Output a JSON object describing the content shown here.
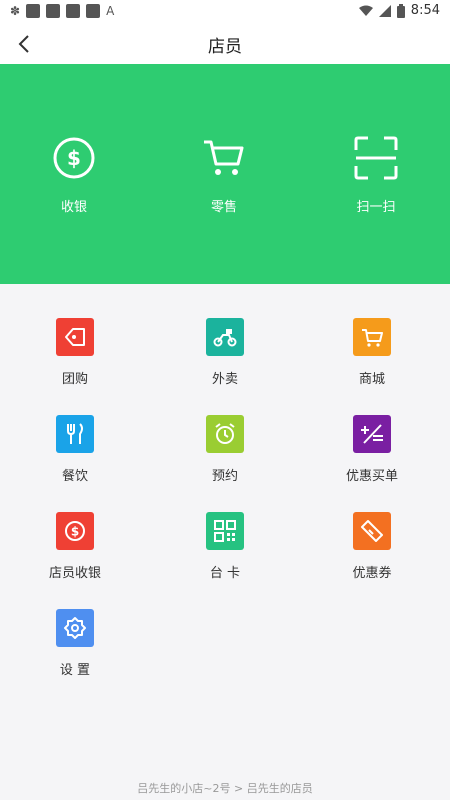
{
  "status_bar": {
    "time": "8:54",
    "notif_icons": [
      "app-icon",
      "app-icon",
      "app-icon",
      "app-icon",
      "app-icon",
      "a-icon"
    ],
    "right_icons": [
      "wifi-icon",
      "signal-icon",
      "battery-icon"
    ]
  },
  "header": {
    "title": "店员"
  },
  "banner": {
    "color": "#2ecc71",
    "items": [
      {
        "label": "收银",
        "icon": "dollar-circle-icon"
      },
      {
        "label": "零售",
        "icon": "cart-icon"
      },
      {
        "label": "扫一扫",
        "icon": "scan-icon"
      }
    ]
  },
  "grid": {
    "items": [
      {
        "label": "团购",
        "icon": "tag-icon",
        "color": "#ef4034"
      },
      {
        "label": "外卖",
        "icon": "scooter-icon",
        "color": "#1bb39d"
      },
      {
        "label": "商城",
        "icon": "shop-cart-icon",
        "color": "#f59b1b"
      },
      {
        "label": "餐饮",
        "icon": "fork-knife-icon",
        "color": "#1aa3e8"
      },
      {
        "label": "预约",
        "icon": "alarm-clock-icon",
        "color": "#9acd32"
      },
      {
        "label": "优惠买单",
        "icon": "discount-icon",
        "color": "#7a1fa2"
      },
      {
        "label": "店员收银",
        "icon": "dollar-icon",
        "color": "#ef4034"
      },
      {
        "label": "台 卡",
        "icon": "qr-code-icon",
        "color": "#26c281"
      },
      {
        "label": "优惠券",
        "icon": "ticket-icon",
        "color": "#f37021"
      },
      {
        "label": "设 置",
        "icon": "settings-icon",
        "color": "#4f8ff0"
      }
    ]
  },
  "footer": {
    "text": "吕先生的小店~2号 > 吕先生的店员"
  }
}
